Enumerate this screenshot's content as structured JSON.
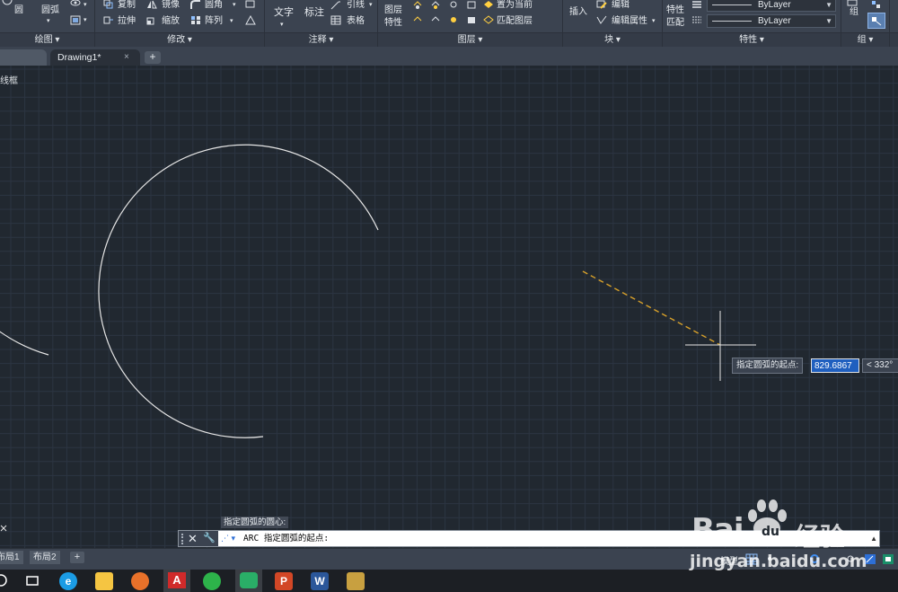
{
  "ribbon": {
    "draw": {
      "circle": "圆",
      "arc": "圆弧",
      "panel": "绘图 ▾"
    },
    "modify": {
      "copy": "复制",
      "mirror": "镜像",
      "fillet": "圆角",
      "stretch": "拉伸",
      "scale": "缩放",
      "array": "阵列",
      "panel": "修改 ▾"
    },
    "annotation": {
      "text": "文字",
      "dimension": "标注",
      "leader": "引线",
      "table": "表格",
      "panel": "注释 ▾"
    },
    "layers": {
      "layer_properties_1": "图层",
      "layer_properties_2": "特性",
      "set_current": "置为当前",
      "match_layer": "匹配图层",
      "panel": "图层 ▾"
    },
    "block": {
      "insert": "插入",
      "edit": "编辑",
      "edit_attributes": "编辑属性",
      "panel": "块 ▾"
    },
    "properties": {
      "match_1": "特性",
      "match_2": "匹配",
      "lineweight": "ByLayer",
      "linetype": "ByLayer",
      "panel": "特性 ▾"
    },
    "groups": {
      "group": "组",
      "panel": "组 ▾"
    }
  },
  "tabs": {
    "doc_name": "Drawing1*",
    "close": "×",
    "add": "+"
  },
  "canvas": {
    "view_label": "线框"
  },
  "dynamic_input": {
    "prompt": "指定圆弧的起点:",
    "value": "829.6867",
    "angle": "< 332°"
  },
  "command": {
    "history": "指定圆弧的圆心:",
    "current": "ARC 指定圆弧的起点:"
  },
  "layout_tabs": [
    "布局1",
    "布局2"
  ],
  "status": {
    "model": "模型"
  },
  "watermark": {
    "brand": "Bai",
    "brand_tail": "u",
    "cn": "经验",
    "url": "jingyan.baidu.com"
  },
  "colors": {
    "canvas_bg": "#212830",
    "grid": "#2c3542",
    "arc": "#e6e6e6",
    "rubberband": "#d8a12a",
    "accent": "#1f5fbf"
  }
}
